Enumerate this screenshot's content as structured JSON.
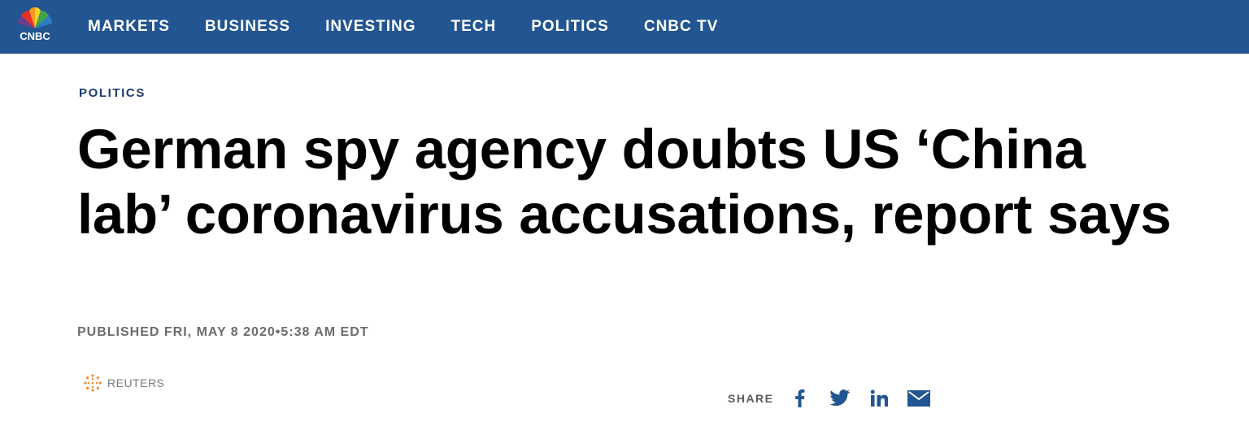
{
  "nav": {
    "logo_text": "CNBC",
    "items": [
      {
        "label": "MARKETS"
      },
      {
        "label": "BUSINESS"
      },
      {
        "label": "INVESTING"
      },
      {
        "label": "TECH"
      },
      {
        "label": "POLITICS"
      },
      {
        "label": "CNBC TV"
      }
    ]
  },
  "article": {
    "category": "POLITICS",
    "headline": "German spy agency doubts US ‘China lab’ coronavirus accusations, report says",
    "published": "PUBLISHED FRI, MAY 8 2020•5:38 AM EDT",
    "source": "REUTERS"
  },
  "share": {
    "label": "SHARE",
    "buttons": [
      {
        "icon": "facebook-icon"
      },
      {
        "icon": "twitter-icon"
      },
      {
        "icon": "linkedin-icon"
      },
      {
        "icon": "email-icon"
      }
    ]
  },
  "colors": {
    "nav_background": "#225591",
    "category": "#1d3b6e",
    "meta_text": "#6c6c6c",
    "share_icons": "#225591"
  }
}
